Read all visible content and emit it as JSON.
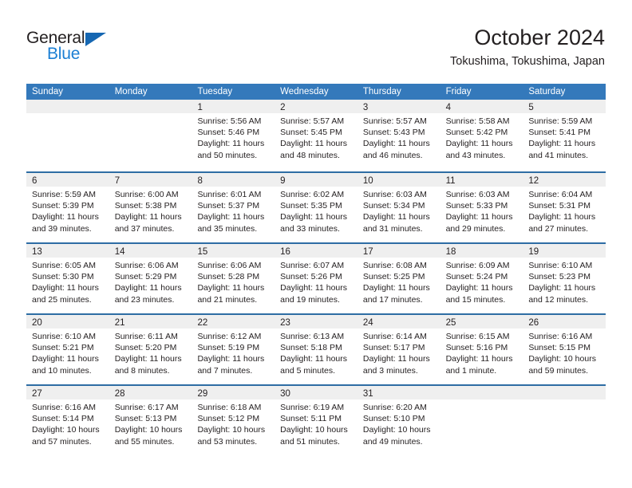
{
  "brand": {
    "name_top": "General",
    "name_bottom": "Blue",
    "accent_color": "#1667b2",
    "blue_text_color": "#1b7fd4"
  },
  "header": {
    "title": "October 2024",
    "subtitle": "Tokushima, Tokushima, Japan"
  },
  "calendar": {
    "header_bg": "#3479bb",
    "row_divider": "#2e6da4",
    "day_head_bg": "#efefef",
    "weekdays": [
      "Sunday",
      "Monday",
      "Tuesday",
      "Wednesday",
      "Thursday",
      "Friday",
      "Saturday"
    ],
    "weeks": [
      [
        {
          "day": "",
          "empty": true
        },
        {
          "day": "",
          "empty": true
        },
        {
          "day": "1",
          "sunrise": "Sunrise: 5:56 AM",
          "sunset": "Sunset: 5:46 PM",
          "daylight1": "Daylight: 11 hours",
          "daylight2": "and 50 minutes."
        },
        {
          "day": "2",
          "sunrise": "Sunrise: 5:57 AM",
          "sunset": "Sunset: 5:45 PM",
          "daylight1": "Daylight: 11 hours",
          "daylight2": "and 48 minutes."
        },
        {
          "day": "3",
          "sunrise": "Sunrise: 5:57 AM",
          "sunset": "Sunset: 5:43 PM",
          "daylight1": "Daylight: 11 hours",
          "daylight2": "and 46 minutes."
        },
        {
          "day": "4",
          "sunrise": "Sunrise: 5:58 AM",
          "sunset": "Sunset: 5:42 PM",
          "daylight1": "Daylight: 11 hours",
          "daylight2": "and 43 minutes."
        },
        {
          "day": "5",
          "sunrise": "Sunrise: 5:59 AM",
          "sunset": "Sunset: 5:41 PM",
          "daylight1": "Daylight: 11 hours",
          "daylight2": "and 41 minutes."
        }
      ],
      [
        {
          "day": "6",
          "sunrise": "Sunrise: 5:59 AM",
          "sunset": "Sunset: 5:39 PM",
          "daylight1": "Daylight: 11 hours",
          "daylight2": "and 39 minutes."
        },
        {
          "day": "7",
          "sunrise": "Sunrise: 6:00 AM",
          "sunset": "Sunset: 5:38 PM",
          "daylight1": "Daylight: 11 hours",
          "daylight2": "and 37 minutes."
        },
        {
          "day": "8",
          "sunrise": "Sunrise: 6:01 AM",
          "sunset": "Sunset: 5:37 PM",
          "daylight1": "Daylight: 11 hours",
          "daylight2": "and 35 minutes."
        },
        {
          "day": "9",
          "sunrise": "Sunrise: 6:02 AM",
          "sunset": "Sunset: 5:35 PM",
          "daylight1": "Daylight: 11 hours",
          "daylight2": "and 33 minutes."
        },
        {
          "day": "10",
          "sunrise": "Sunrise: 6:03 AM",
          "sunset": "Sunset: 5:34 PM",
          "daylight1": "Daylight: 11 hours",
          "daylight2": "and 31 minutes."
        },
        {
          "day": "11",
          "sunrise": "Sunrise: 6:03 AM",
          "sunset": "Sunset: 5:33 PM",
          "daylight1": "Daylight: 11 hours",
          "daylight2": "and 29 minutes."
        },
        {
          "day": "12",
          "sunrise": "Sunrise: 6:04 AM",
          "sunset": "Sunset: 5:31 PM",
          "daylight1": "Daylight: 11 hours",
          "daylight2": "and 27 minutes."
        }
      ],
      [
        {
          "day": "13",
          "sunrise": "Sunrise: 6:05 AM",
          "sunset": "Sunset: 5:30 PM",
          "daylight1": "Daylight: 11 hours",
          "daylight2": "and 25 minutes."
        },
        {
          "day": "14",
          "sunrise": "Sunrise: 6:06 AM",
          "sunset": "Sunset: 5:29 PM",
          "daylight1": "Daylight: 11 hours",
          "daylight2": "and 23 minutes."
        },
        {
          "day": "15",
          "sunrise": "Sunrise: 6:06 AM",
          "sunset": "Sunset: 5:28 PM",
          "daylight1": "Daylight: 11 hours",
          "daylight2": "and 21 minutes."
        },
        {
          "day": "16",
          "sunrise": "Sunrise: 6:07 AM",
          "sunset": "Sunset: 5:26 PM",
          "daylight1": "Daylight: 11 hours",
          "daylight2": "and 19 minutes."
        },
        {
          "day": "17",
          "sunrise": "Sunrise: 6:08 AM",
          "sunset": "Sunset: 5:25 PM",
          "daylight1": "Daylight: 11 hours",
          "daylight2": "and 17 minutes."
        },
        {
          "day": "18",
          "sunrise": "Sunrise: 6:09 AM",
          "sunset": "Sunset: 5:24 PM",
          "daylight1": "Daylight: 11 hours",
          "daylight2": "and 15 minutes."
        },
        {
          "day": "19",
          "sunrise": "Sunrise: 6:10 AM",
          "sunset": "Sunset: 5:23 PM",
          "daylight1": "Daylight: 11 hours",
          "daylight2": "and 12 minutes."
        }
      ],
      [
        {
          "day": "20",
          "sunrise": "Sunrise: 6:10 AM",
          "sunset": "Sunset: 5:21 PM",
          "daylight1": "Daylight: 11 hours",
          "daylight2": "and 10 minutes."
        },
        {
          "day": "21",
          "sunrise": "Sunrise: 6:11 AM",
          "sunset": "Sunset: 5:20 PM",
          "daylight1": "Daylight: 11 hours",
          "daylight2": "and 8 minutes."
        },
        {
          "day": "22",
          "sunrise": "Sunrise: 6:12 AM",
          "sunset": "Sunset: 5:19 PM",
          "daylight1": "Daylight: 11 hours",
          "daylight2": "and 7 minutes."
        },
        {
          "day": "23",
          "sunrise": "Sunrise: 6:13 AM",
          "sunset": "Sunset: 5:18 PM",
          "daylight1": "Daylight: 11 hours",
          "daylight2": "and 5 minutes."
        },
        {
          "day": "24",
          "sunrise": "Sunrise: 6:14 AM",
          "sunset": "Sunset: 5:17 PM",
          "daylight1": "Daylight: 11 hours",
          "daylight2": "and 3 minutes."
        },
        {
          "day": "25",
          "sunrise": "Sunrise: 6:15 AM",
          "sunset": "Sunset: 5:16 PM",
          "daylight1": "Daylight: 11 hours",
          "daylight2": "and 1 minute."
        },
        {
          "day": "26",
          "sunrise": "Sunrise: 6:16 AM",
          "sunset": "Sunset: 5:15 PM",
          "daylight1": "Daylight: 10 hours",
          "daylight2": "and 59 minutes."
        }
      ],
      [
        {
          "day": "27",
          "sunrise": "Sunrise: 6:16 AM",
          "sunset": "Sunset: 5:14 PM",
          "daylight1": "Daylight: 10 hours",
          "daylight2": "and 57 minutes."
        },
        {
          "day": "28",
          "sunrise": "Sunrise: 6:17 AM",
          "sunset": "Sunset: 5:13 PM",
          "daylight1": "Daylight: 10 hours",
          "daylight2": "and 55 minutes."
        },
        {
          "day": "29",
          "sunrise": "Sunrise: 6:18 AM",
          "sunset": "Sunset: 5:12 PM",
          "daylight1": "Daylight: 10 hours",
          "daylight2": "and 53 minutes."
        },
        {
          "day": "30",
          "sunrise": "Sunrise: 6:19 AM",
          "sunset": "Sunset: 5:11 PM",
          "daylight1": "Daylight: 10 hours",
          "daylight2": "and 51 minutes."
        },
        {
          "day": "31",
          "sunrise": "Sunrise: 6:20 AM",
          "sunset": "Sunset: 5:10 PM",
          "daylight1": "Daylight: 10 hours",
          "daylight2": "and 49 minutes."
        },
        {
          "day": "",
          "empty": true
        },
        {
          "day": "",
          "empty": true
        }
      ]
    ]
  }
}
